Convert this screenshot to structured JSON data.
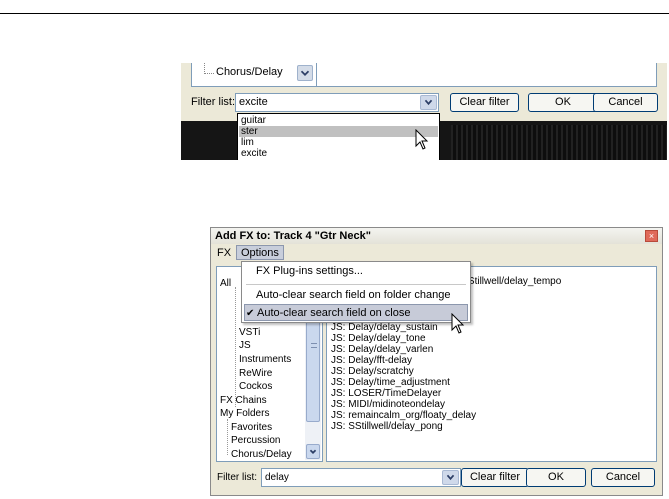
{
  "shot1": {
    "tree_item": "Chorus/Delay",
    "filter_label": "Filter list:",
    "filter_value": "excite",
    "clear_filter": "Clear filter",
    "ok": "OK",
    "cancel": "Cancel",
    "dropdown_items": [
      "guitar",
      "ster",
      "lim",
      "excite"
    ],
    "selected_item": "ster"
  },
  "shot2": {
    "title": "Add FX to: Track 4 \"Gtr Neck\"",
    "close_glyph": "×",
    "menu": {
      "fx": "FX",
      "options": "Options"
    },
    "options_menu": {
      "items": [
        "FX Plug-ins settings...",
        "Auto-clear search field on folder change",
        "Auto-clear search field on close"
      ],
      "checked_index": 2,
      "check_glyph": "✔"
    },
    "tree": {
      "all_fragment": "All",
      "items": [
        "VSTi",
        "JS",
        "Instruments",
        "ReWire",
        "Cockos"
      ],
      "fx_chains": "FX Chains",
      "my_folders": "My Folders",
      "folders": [
        "Favorites",
        "Percussion",
        "Chorus/Delay"
      ]
    },
    "plugin_list": {
      "first_row_fragment": "S: SStillwell/delay_tempo",
      "partial_row": "JS: Delay/delay_sustain",
      "items": [
        "JS: Delay/delay_tone",
        "JS: Delay/delay_varlen",
        "JS: Delay/fft-delay",
        "JS: Delay/scratchy",
        "JS: Delay/time_adjustment",
        "JS: LOSER/TimeDelayer",
        "JS: MIDI/midinoteondelay",
        "JS: remaincalm_org/floaty_delay",
        "JS: SStillwell/delay_pong"
      ]
    },
    "filter_label": "Filter list:",
    "filter_value": "delay",
    "clear_filter": "Clear filter",
    "ok": "OK",
    "cancel": "Cancel"
  }
}
